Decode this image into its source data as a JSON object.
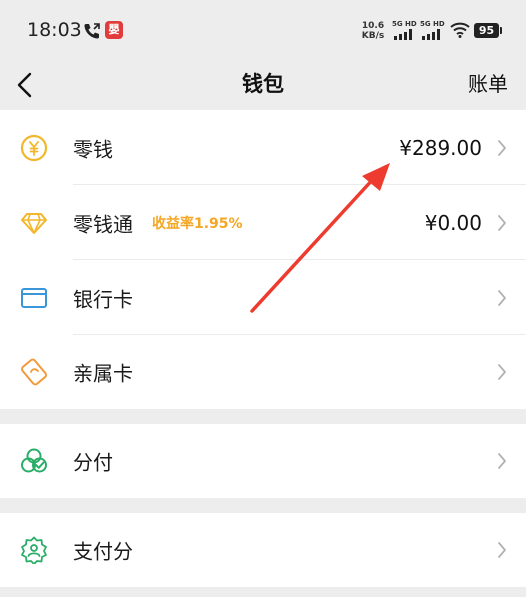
{
  "status_bar": {
    "time": "18:03",
    "app_badge": "嬰",
    "net_speed_value": "10.6",
    "net_speed_unit": "KB/s",
    "signal_1": "5G HD",
    "signal_2": "5G HD",
    "battery": "95"
  },
  "nav": {
    "title": "钱包",
    "bill_label": "账单"
  },
  "rows": {
    "change": {
      "label": "零钱",
      "value": "¥289.00"
    },
    "licaitong": {
      "label": "零钱通",
      "rate": "收益率1.95%",
      "value": "¥0.00"
    },
    "bank_card": {
      "label": "银行卡"
    },
    "family_card": {
      "label": "亲属卡"
    },
    "fenfu": {
      "label": "分付"
    },
    "pay_score": {
      "label": "支付分"
    }
  },
  "colors": {
    "yellow": "#f2b72a",
    "blue": "#3b96d9",
    "orange": "#f29a3a",
    "green": "#2aae67",
    "annotation_arrow": "#ee3b2f"
  }
}
